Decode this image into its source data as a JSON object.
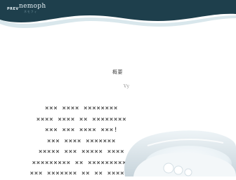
{
  "header": {
    "logo_prefix": "PREV",
    "logo_name": "nemoph",
    "logo_sub": "ネモフィ",
    "colors": {
      "band": "#1e3f4c",
      "band_light": "#d9e7ec",
      "logo_text": "#e8f2f6"
    }
  },
  "main": {
    "heading": "概要",
    "subheading": "Vy",
    "lines": [
      "××× ×××× ××××××××",
      "×××× ×××× ×× ××××××××",
      "××× ××× ×××× ×××!",
      "××× ×××× ×××××××",
      "××××× ××× ××××× ××××",
      "××××××××× ×× ××××××××××",
      "××× ××××××× ×× ×× ××××××"
    ]
  },
  "product_image": {
    "icon": "pillow-product-image",
    "colors": {
      "surface": "#e9f1f5",
      "shadow": "#c7d4db",
      "highlight": "#f7fafc"
    }
  }
}
